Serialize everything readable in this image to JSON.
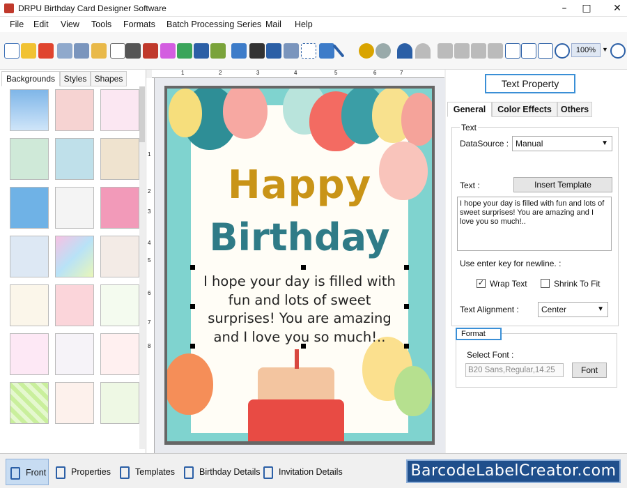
{
  "window": {
    "title": "DRPU Birthday Card Designer Software"
  },
  "menu": [
    "File",
    "Edit",
    "View",
    "Tools",
    "Formats",
    "Batch Processing Series",
    "Mail",
    "Help"
  ],
  "toolbar": {
    "zoom": "100%"
  },
  "left_panel": {
    "tabs": [
      "Backgrounds",
      "Styles",
      "Shapes"
    ],
    "active_tab": "Backgrounds"
  },
  "ruler": {
    "top_marks": [
      "1",
      "2",
      "3",
      "4",
      "5",
      "6",
      "7"
    ],
    "left_marks": [
      "1",
      "2",
      "3",
      "4",
      "5",
      "6",
      "7",
      "8"
    ]
  },
  "card": {
    "heading1": "Happy",
    "heading2": "Birthday",
    "message": "I hope your day is filled with fun and lots of sweet surprises! You are amazing and I love you so much!.."
  },
  "right_panel": {
    "title": "Text Property",
    "tabs": [
      "General",
      "Color Effects",
      "Others"
    ],
    "active_tab": "General",
    "text_group": {
      "legend": "Text",
      "datasource_label": "DataSource :",
      "datasource_value": "Manual",
      "text_label": "Text :",
      "insert_template": "Insert Template",
      "text_value": "I hope your day is filled with fun and lots of sweet surprises! You are amazing and I love you so much!..",
      "newline_hint": "Use enter key for newline. :",
      "wrap_text": "Wrap Text",
      "shrink_to_fit": "Shrink To Fit",
      "alignment_label": "Text Alignment :",
      "alignment_value": "Center"
    },
    "format_group": {
      "legend": "Format",
      "select_font_label": "Select Font :",
      "font_value": "B20 Sans,Regular,14.25",
      "font_button": "Font"
    }
  },
  "statusbar": {
    "buttons": [
      "Front",
      "Properties",
      "Templates",
      "Birthday Details",
      "Invitation Details"
    ],
    "brand": "BarcodeLabelCreator.com"
  }
}
